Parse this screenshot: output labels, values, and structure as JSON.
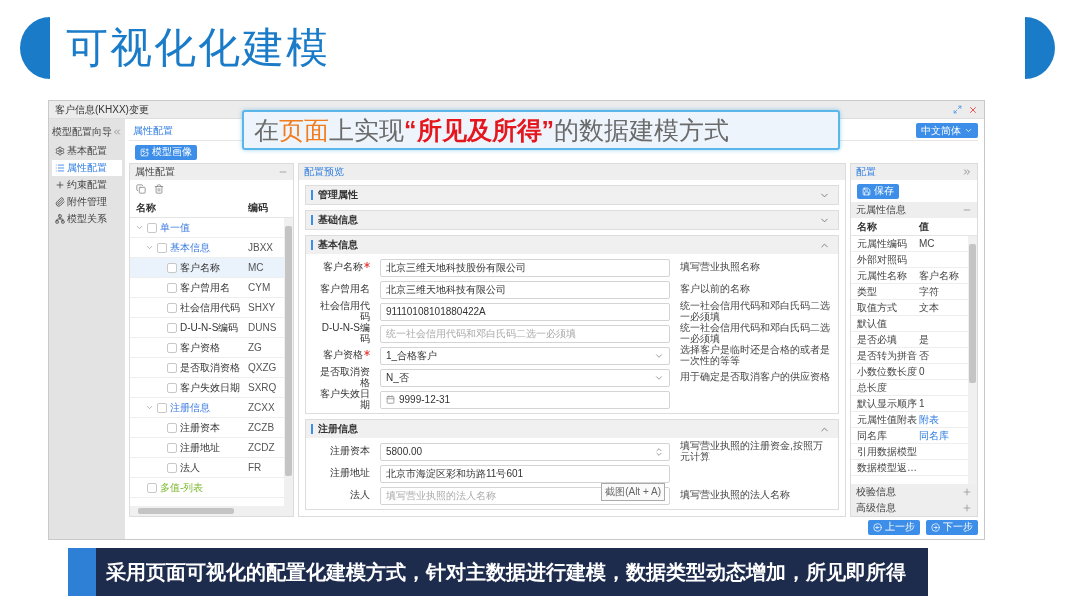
{
  "slide": {
    "title": "可视化化建模"
  },
  "callout": {
    "parts": [
      {
        "text": "在",
        "kind": "plain"
      },
      {
        "text": "页面",
        "kind": "highlight"
      },
      {
        "text": "上实现",
        "kind": "plain"
      },
      {
        "text": "“所见及所得”",
        "kind": "emphasis"
      },
      {
        "text": "的数据建模方式",
        "kind": "plain"
      }
    ]
  },
  "window": {
    "title": "客户信息(KHXX)变更"
  },
  "nav": {
    "title": "模型配置向导",
    "items": [
      {
        "label": "基本配置",
        "kind": "gear",
        "selected": false
      },
      {
        "label": "属性配置",
        "kind": "list",
        "selected": true
      },
      {
        "label": "约束配置",
        "kind": "plus",
        "selected": false
      },
      {
        "label": "附件管理",
        "kind": "attachment",
        "selected": false
      },
      {
        "label": "模型关系",
        "kind": "hierarchy",
        "selected": false
      }
    ]
  },
  "breadcrumb": "属性配置",
  "language_select": "中文简体",
  "portrait_button": "模型画像",
  "tree_panel": {
    "title": "属性配置",
    "columns": [
      "名称",
      "编码"
    ],
    "rows": [
      {
        "label": "单一值",
        "kind": "group",
        "expanded": true,
        "checked": false,
        "selected": false,
        "children": [
          {
            "label": "基本信息",
            "code": "JBXX",
            "kind": "group",
            "expanded": true,
            "checked": false,
            "selected": false,
            "children": [
              {
                "label": "客户名称",
                "code": "MC",
                "kind": "item",
                "checked": false,
                "selected": true
              },
              {
                "label": "客户曾用名",
                "code": "CYM",
                "kind": "item",
                "checked": false,
                "selected": false
              },
              {
                "label": "社会信用代码",
                "code": "SHXY",
                "kind": "item",
                "checked": false,
                "selected": false
              },
              {
                "label": "D-U-N-S编码",
                "code": "DUNS",
                "kind": "item",
                "checked": false,
                "selected": false
              },
              {
                "label": "客户资格",
                "code": "ZG",
                "kind": "item",
                "checked": false,
                "selected": false
              },
              {
                "label": "是否取消资格",
                "code": "QXZG",
                "kind": "item",
                "checked": false,
                "selected": false
              },
              {
                "label": "客户失效日期",
                "code": "SXRQ",
                "kind": "item",
                "checked": false,
                "selected": false
              }
            ]
          },
          {
            "label": "注册信息",
            "code": "ZCXX",
            "kind": "group",
            "expanded": true,
            "checked": false,
            "selected": false,
            "children": [
              {
                "label": "注册资本",
                "code": "ZCZB",
                "kind": "item",
                "checked": false,
                "selected": false
              },
              {
                "label": "注册地址",
                "code": "ZCDZ",
                "kind": "item",
                "checked": false,
                "selected": false
              },
              {
                "label": "法人",
                "code": "FR",
                "kind": "item",
                "checked": false,
                "selected": false
              }
            ]
          }
        ]
      },
      {
        "label": "多值-列表",
        "kind": "list",
        "checked": false,
        "selected": false
      }
    ]
  },
  "preview": {
    "title": "配置预览",
    "sections": [
      {
        "title": "管理属性",
        "expanded": false
      },
      {
        "title": "基础信息",
        "expanded": false
      },
      {
        "title": "基本信息",
        "expanded": true,
        "fields": [
          {
            "label": "客户名称",
            "required": true,
            "kind": "text",
            "value": "北京三维天地科技股份有限公司",
            "hint": "填写营业执照名称"
          },
          {
            "label": "客户曾用名",
            "required": false,
            "kind": "text",
            "value": "北京三维天地科技有限公司",
            "hint": "客户以前的名称"
          },
          {
            "label": "社会信用代码",
            "required": false,
            "kind": "text",
            "value": "91110108101880422A",
            "hint": "统一社会信用代码和邓白氏码二选一必须填"
          },
          {
            "label": "D-U-N-S编码",
            "required": false,
            "kind": "text",
            "placeholder": "统一社会信用代码和邓白氏码二选一必须填",
            "hint": "统一社会信用代码和邓白氏码二选一必须填"
          },
          {
            "label": "客户资格",
            "required": true,
            "kind": "select",
            "value": "1_合格客户",
            "hint": "选择客户是临时还是合格的或者是一次性的等等"
          },
          {
            "label": "是否取消资格",
            "required": false,
            "kind": "select",
            "value": "N_否",
            "hint": "用于确定是否取消客户的供应资格"
          },
          {
            "label": "客户失效日期",
            "required": false,
            "kind": "date",
            "value": "9999-12-31"
          }
        ]
      },
      {
        "title": "注册信息",
        "expanded": true,
        "fields": [
          {
            "label": "注册资本",
            "required": false,
            "kind": "number",
            "value": "5800.00",
            "hint": "填写营业执照的注册资金,按照万元计算"
          },
          {
            "label": "注册地址",
            "required": false,
            "kind": "text",
            "value": "北京市海淀区彩和坊路11号601",
            "tooltip": "截图(Alt + A)"
          },
          {
            "label": "法人",
            "required": false,
            "kind": "text",
            "placeholder": "填写营业执照的法人名称",
            "hint": "填写营业执照的法人名称"
          }
        ]
      }
    ]
  },
  "config_panel": {
    "title": "配置",
    "save_button": "保存",
    "section": "元属性信息",
    "columns": [
      "名称",
      "值"
    ],
    "rows": [
      {
        "name": "元属性编码",
        "value": "MC",
        "kind": "text"
      },
      {
        "name": "外部对照码"
      },
      {
        "name": "元属性名称",
        "value": "客户名称",
        "kind": "text"
      },
      {
        "name": "类型",
        "value": "字符",
        "kind": "text"
      },
      {
        "name": "取值方式",
        "value": "文本",
        "kind": "text"
      },
      {
        "name": "默认值"
      },
      {
        "name": "是否必填",
        "value": "是",
        "kind": "text"
      },
      {
        "name": "是否转为拼音",
        "value": "否",
        "kind": "text"
      },
      {
        "name": "小数位数长度",
        "value": "0",
        "kind": "text"
      },
      {
        "name": "总长度"
      },
      {
        "name": "默认显示顺序",
        "value": "1",
        "kind": "text"
      },
      {
        "name": "元属性值附表",
        "value": "附表",
        "kind": "link"
      },
      {
        "name": "同名库",
        "value": "同名库",
        "kind": "link"
      },
      {
        "name": "引用数据模型"
      },
      {
        "name": "数据模型返…"
      }
    ],
    "collapsed_sections": [
      "校验信息",
      "高级信息"
    ]
  },
  "footer_buttons": [
    {
      "label": "上一步",
      "kind": "prev"
    },
    {
      "label": "下一步",
      "kind": "next"
    }
  ],
  "banner": "采用页面可视化的配置化建模方式，针对主数据进行建模，数据类型动态增加，所见即所得"
}
